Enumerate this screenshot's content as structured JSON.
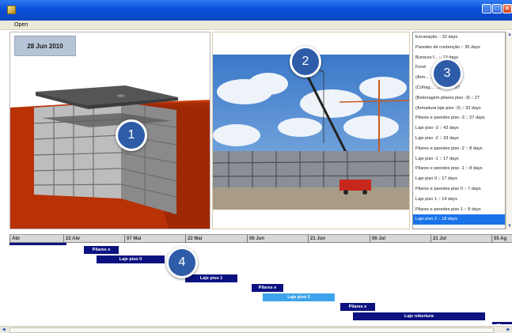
{
  "window": {
    "title": "",
    "menu": [
      "Open"
    ]
  },
  "view3d": {
    "date": "28 Jun 2010"
  },
  "markers": [
    "1",
    "2",
    "3",
    "4"
  ],
  "tasks": [
    {
      "label": "Escavação :: 32 days",
      "selected": false
    },
    {
      "label": "Paredes de contenção :: 35 days",
      "selected": false
    },
    {
      "label": "Buracos f... :: 13 days",
      "selected": false
    },
    {
      "label": "Fund",
      "selected": false
    },
    {
      "label": "(Arm... ...o -3) :: 27",
      "selected": false
    },
    {
      "label": "(Cofrag... ...so -3) :: 27",
      "selected": false
    },
    {
      "label": "(Betonagem pilares piso -3) :: 27",
      "selected": false
    },
    {
      "label": "(Armadura laje piso -3) :: 32 days",
      "selected": false
    },
    {
      "label": "Pilares e paredes piso -3 :: 27 days",
      "selected": false
    },
    {
      "label": "Laje piso -3 :: 43 days",
      "selected": false
    },
    {
      "label": "Laje piso -2 :: 33 days",
      "selected": false
    },
    {
      "label": "Pilares e paredes piso -2 :: 8 days",
      "selected": false
    },
    {
      "label": "Laje piso -1 :: 17 days",
      "selected": false
    },
    {
      "label": "Pilares e paredes piso -1 :: 8 days",
      "selected": false
    },
    {
      "label": "Laje piso 0 :: 17 days",
      "selected": false
    },
    {
      "label": "Pilares e paredes piso 0 :: 7 days",
      "selected": false
    },
    {
      "label": "Laje piso 1 :: 14 days",
      "selected": false
    },
    {
      "label": "Pilares e paredes piso 1 :: 8 days",
      "selected": false
    },
    {
      "label": "Laje piso 2 :: 18 days",
      "selected": true
    }
  ],
  "timeline": {
    "ticks": [
      "Abr",
      "22 Abr",
      "07 Mai",
      "22 Mai",
      "06 Jun",
      "21 Jun",
      "06 Jul",
      "21 Jul",
      "05 Ag"
    ],
    "bars": [
      {
        "label": "Pilares e",
        "active": false
      },
      {
        "label": "Laje piso 0",
        "active": false
      },
      {
        "label": "Laje piso 1",
        "active": false
      },
      {
        "label": "Pilares e",
        "active": false
      },
      {
        "label": "Laje piso 2",
        "active": true
      },
      {
        "label": "Pilares e",
        "active": false
      },
      {
        "label": "Laje robertura",
        "active": false
      },
      {
        "label": "Muro",
        "active": false
      }
    ]
  },
  "colors": {
    "titlebar": "#0a4fd8",
    "bar": "#0c1280",
    "bar_active": "#3da4ec",
    "selection": "#1a73e8",
    "marker": "#2e5ca8"
  }
}
